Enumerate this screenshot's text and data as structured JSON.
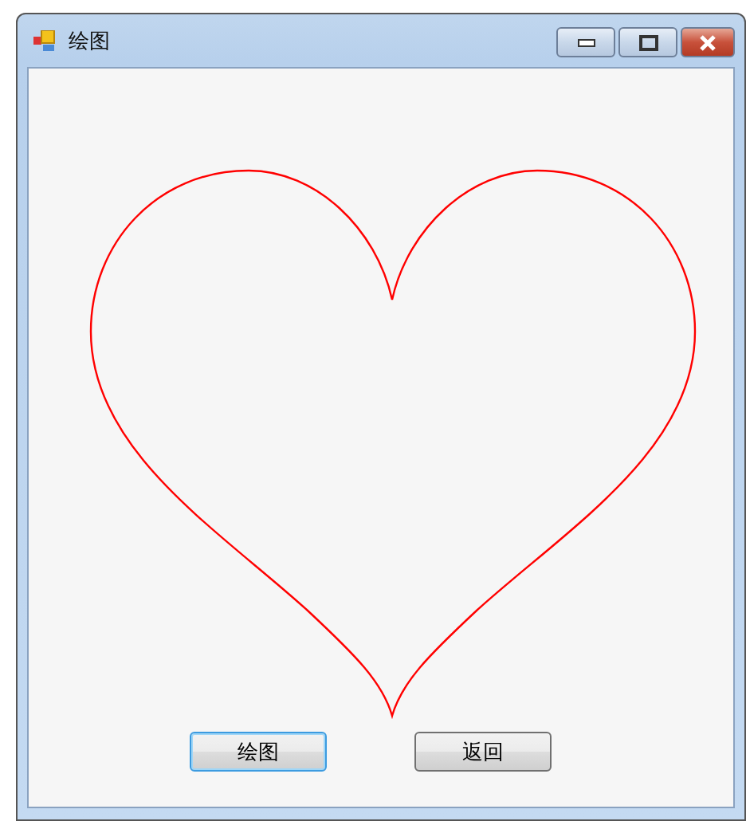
{
  "window": {
    "title": "绘图"
  },
  "buttons": [
    {
      "label": "绘图",
      "focused": true
    },
    {
      "label": "返回",
      "focused": false
    }
  ]
}
